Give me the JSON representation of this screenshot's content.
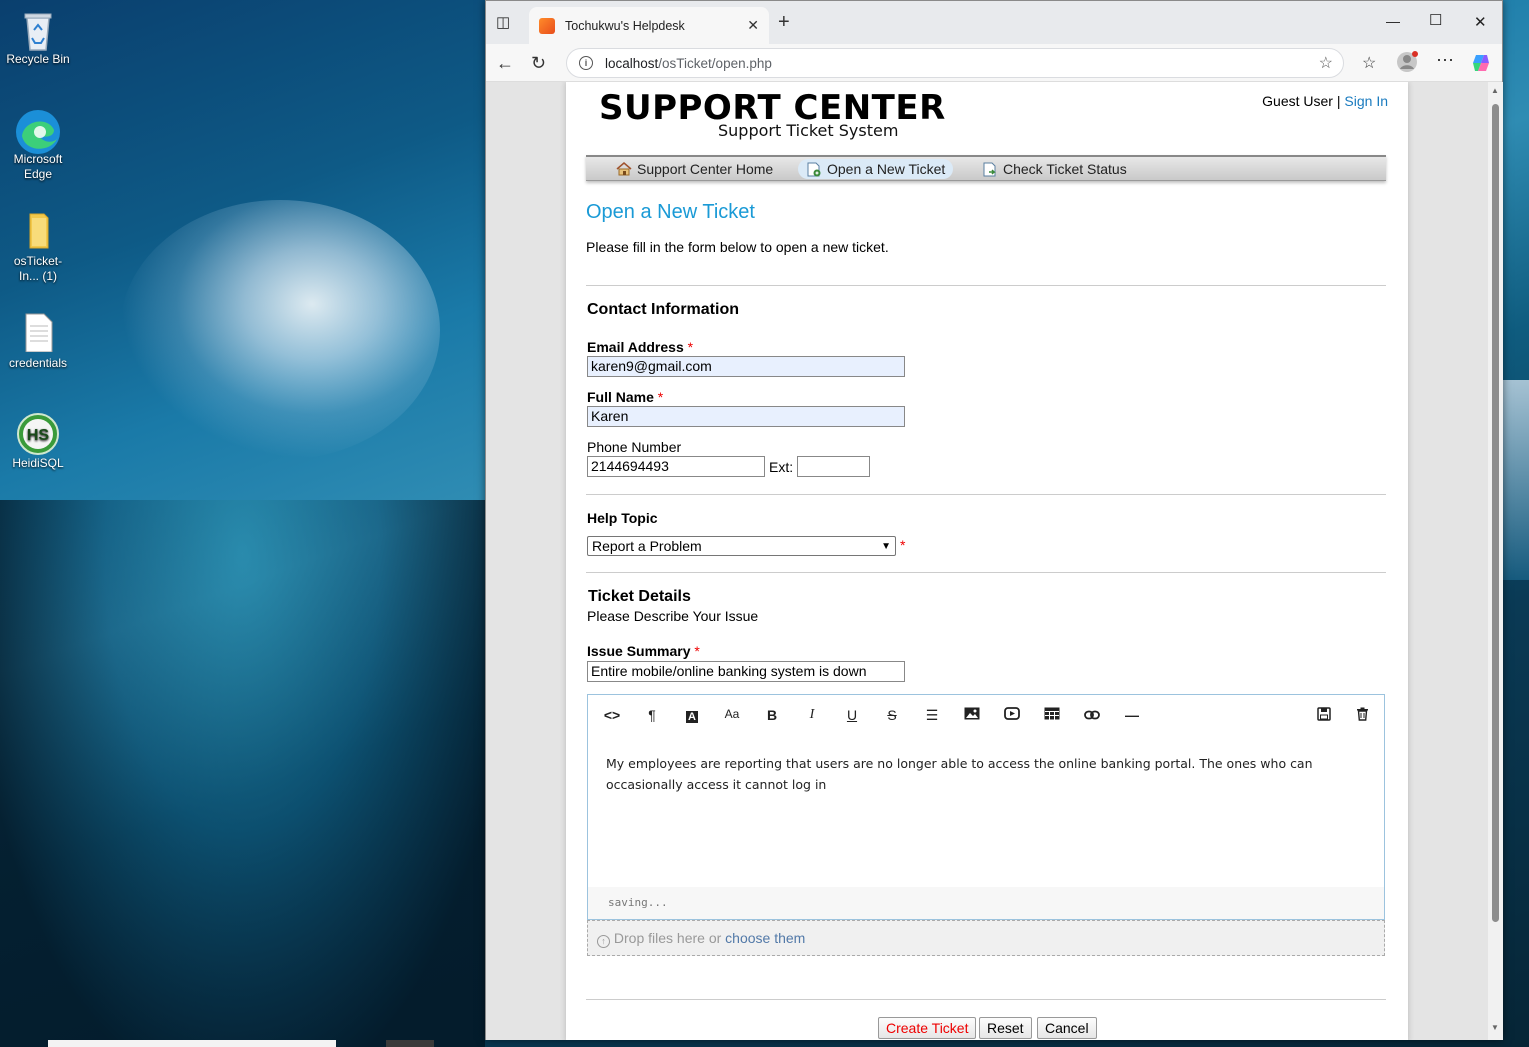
{
  "desktop": {
    "icons": [
      {
        "label": "Recycle Bin"
      },
      {
        "label": "Microsoft Edge"
      },
      {
        "label": "osTicket-In... (1)"
      },
      {
        "label": "credentials"
      },
      {
        "label": "HeidiSQL"
      }
    ]
  },
  "browser": {
    "tab_title": "Tochukwu's Helpdesk",
    "url_host": "localhost",
    "url_path": "/osTicket/open.php"
  },
  "site": {
    "logo_title": "SUPPORT CENTER",
    "logo_subtitle": "Support Ticket System",
    "user_label": "Guest User",
    "separator": "|",
    "sign_in": "Sign In",
    "nav": [
      {
        "label": "Support Center Home",
        "icon": "home-icon"
      },
      {
        "label": "Open a New Ticket",
        "icon": "new-ticket-icon",
        "active": true
      },
      {
        "label": "Check Ticket Status",
        "icon": "ticket-status-icon"
      }
    ]
  },
  "form": {
    "heading": "Open a New Ticket",
    "intro": "Please fill in the form below to open a new ticket.",
    "contact_heading": "Contact Information",
    "email_label": "Email Address",
    "email_value": "karen9@gmail.com",
    "name_label": "Full Name",
    "name_value": "Karen",
    "phone_label": "Phone Number",
    "phone_value": "2144694493",
    "ext_label": "Ext:",
    "ext_value": "",
    "required_mark": "*",
    "help_topic_heading": "Help Topic",
    "help_topic_value": "Report a Problem",
    "ticket_details_heading": "Ticket Details",
    "ticket_details_sub": "Please Describe Your Issue",
    "issue_summary_label": "Issue Summary",
    "issue_summary_value": "Entire mobile/online banking system is down",
    "body_text": "My employees are reporting that users are no longer able to access the online banking portal. The ones who can occasionally access it cannot log in",
    "editor_status": "saving...",
    "drop_text": "Drop files here or",
    "drop_link": "choose them",
    "buttons": {
      "create": "Create Ticket",
      "reset": "Reset",
      "cancel": "Cancel"
    }
  },
  "colors": {
    "accent": "#1a9ad6",
    "link": "#1a7bbf",
    "required": "#ee0000"
  }
}
